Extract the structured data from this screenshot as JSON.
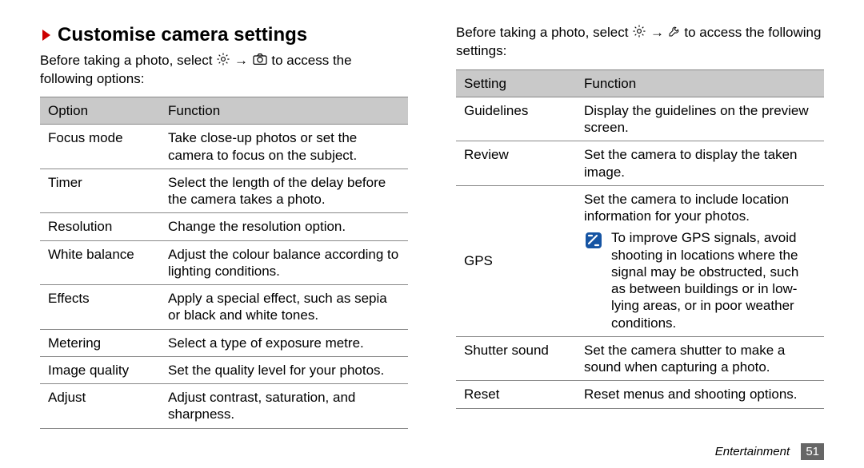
{
  "heading": "Customise camera settings",
  "col1": {
    "intro_pre": "Before taking a photo, select ",
    "intro_mid": " → ",
    "intro_post": " to access the following options:",
    "th_option": "Option",
    "th_function": "Function",
    "rows": [
      {
        "opt": "Focus mode",
        "fn": "Take close-up photos or set the camera to focus on the subject."
      },
      {
        "opt": "Timer",
        "fn": "Select the length of the delay before the camera takes a photo."
      },
      {
        "opt": "Resolution",
        "fn": "Change the resolution option."
      },
      {
        "opt": "White balance",
        "fn": "Adjust the colour balance according to lighting conditions."
      },
      {
        "opt": "Effects",
        "fn": "Apply a special effect, such as sepia or black and white tones."
      },
      {
        "opt": "Metering",
        "fn": "Select a type of exposure metre."
      },
      {
        "opt": "Image quality",
        "fn": "Set the quality level for your photos."
      },
      {
        "opt": "Adjust",
        "fn": "Adjust contrast, saturation, and sharpness."
      }
    ]
  },
  "col2": {
    "intro_pre": "Before taking a photo, select ",
    "intro_mid": " → ",
    "intro_post": " to access the following settings:",
    "th_setting": "Setting",
    "th_function": "Function",
    "rows_simple": [
      {
        "opt": "Guidelines",
        "fn": "Display the guidelines on the preview screen."
      },
      {
        "opt": "Review",
        "fn": "Set the camera to display the taken image."
      }
    ],
    "gps": {
      "opt": "GPS",
      "fn_main": "Set the camera to include location information for your photos.",
      "fn_note": "To improve GPS signals, avoid shooting in locations where the signal may be obstructed, such as between buildings or in low-lying areas, or in poor weather conditions."
    },
    "rows_after": [
      {
        "opt": "Shutter sound",
        "fn": "Set the camera shutter to make a sound when capturing a photo."
      },
      {
        "opt": "Reset",
        "fn": "Reset menus and shooting options."
      }
    ]
  },
  "footer": {
    "section": "Entertainment",
    "page": "51"
  }
}
